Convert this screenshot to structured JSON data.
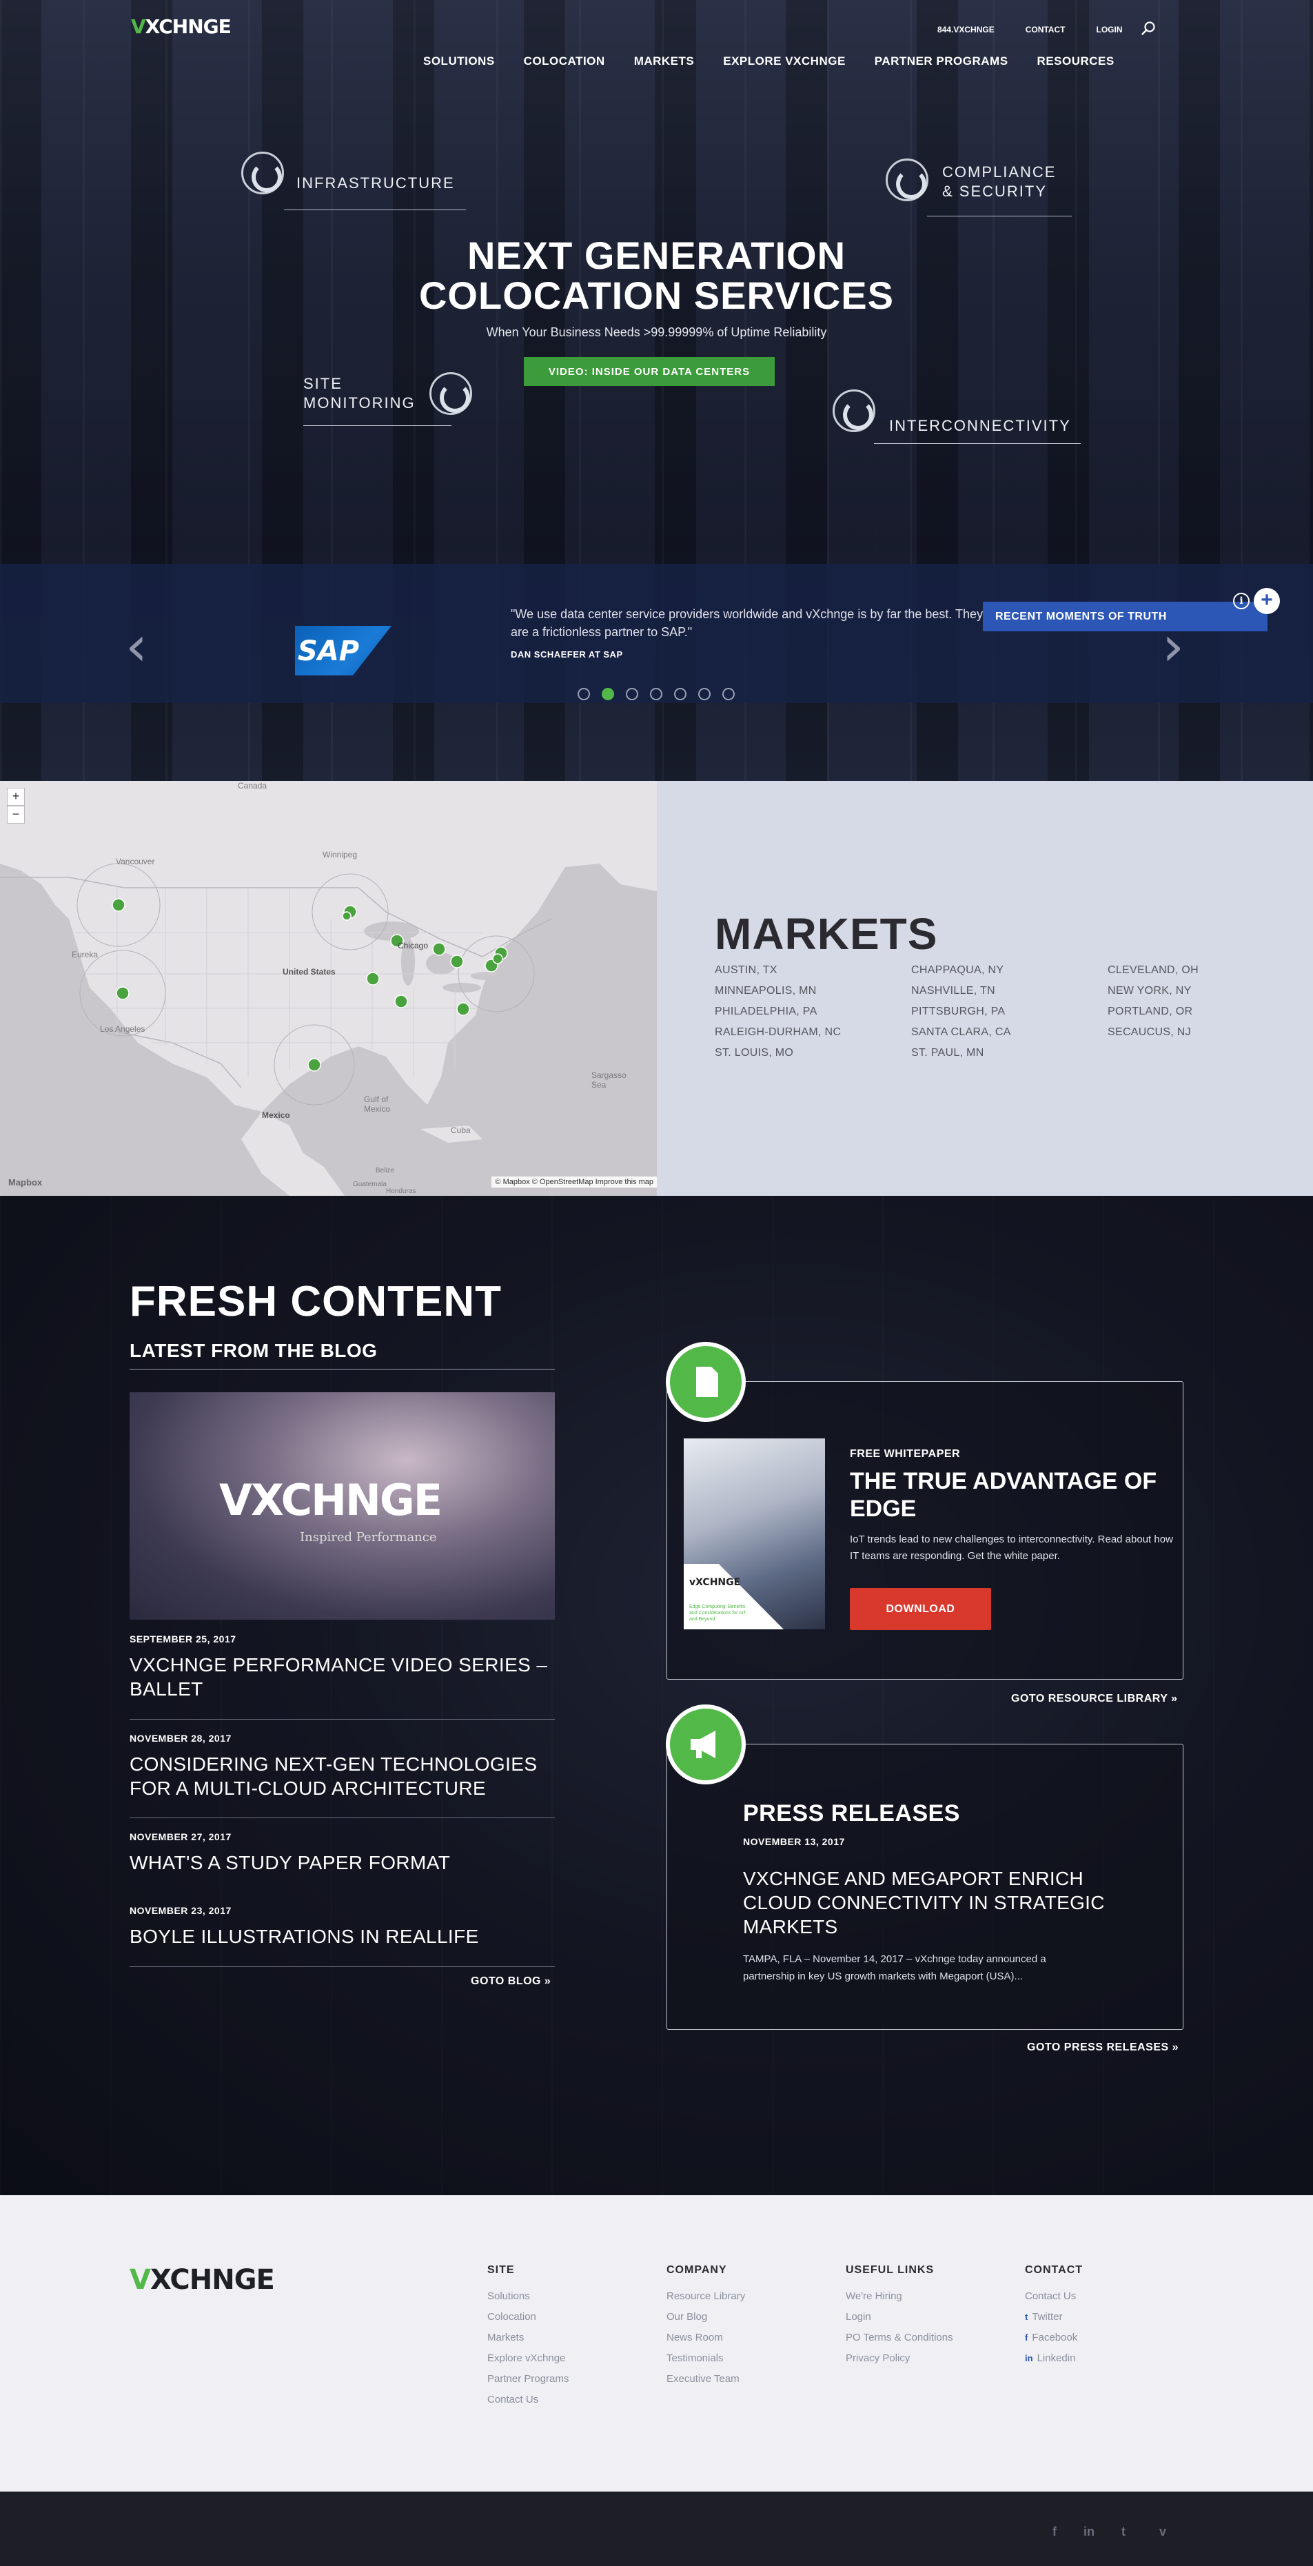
{
  "brand": {
    "logo_v": "V",
    "logo_rest": "XCHNGE",
    "logo_full": "vXCHNGE",
    "accent": "#52b848",
    "blue": "#2c57b6",
    "red": "#d9382c"
  },
  "utility_nav": {
    "phone": "844.VXCHNGE",
    "contact": "CONTACT",
    "login": "LOGIN",
    "search_icon": "search-icon"
  },
  "main_nav": [
    "SOLUTIONS",
    "COLOCATION",
    "MARKETS",
    "EXPLORE VXCHNGE",
    "PARTNER PROGRAMS",
    "RESOURCES"
  ],
  "hero": {
    "title_line1": "NEXT GENERATION",
    "title_line2": "COLOCATION SERVICES",
    "subtitle": "When Your Business Needs >99.99999% of Uptime Reliability",
    "button": "VIDEO: INSIDE OUR DATA CENTERS",
    "features": {
      "infrastructure": "INFRASTRUCTURE",
      "compliance_1": "COMPLIANCE",
      "compliance_2": "& SECURITY",
      "monitoring_1": "SITE",
      "monitoring_2": "MONITORING",
      "interconnectivity": "INTERCONNECTIVITY"
    }
  },
  "testimonial": {
    "logo": "SAP",
    "quote": "\"We use data center service providers worldwide and vXchnge is by far the best. They are a frictionless partner to SAP.\"",
    "author": "DAN SCHAEFER AT SAP",
    "moments_button": "RECENT MOMENTS OF TRUTH",
    "info": "i",
    "plus": "+",
    "prev": "‹",
    "next": "›",
    "dot_count": 7,
    "active_dot": 2
  },
  "map": {
    "zoom_in": "+",
    "zoom_out": "−",
    "attribution": "© Mapbox © OpenStreetMap Improve this map",
    "mapbox": "Mapbox",
    "labels": {
      "canada": "Canada",
      "vancouver": "Vancouver",
      "winnipeg": "Winnipeg",
      "united_states": "United States",
      "chicago": "Chicago",
      "los_angeles": "Los Angeles",
      "eureka": "Eureka",
      "gulf": "Gulf of Mexico",
      "mexico": "Mexico",
      "cuba": "Cuba",
      "sargasso": "Sargasso Sea",
      "guatemala": "Guatemala",
      "belize": "Belize",
      "honduras": "Honduras"
    }
  },
  "markets": {
    "title": "MARKETS",
    "cities": [
      "AUSTIN, TX",
      "CHAPPAQUA, NY",
      "CLEVELAND, OH",
      "MINNEAPOLIS, MN",
      "NASHVILLE, TN",
      "NEW YORK, NY",
      "PHILADELPHIA, PA",
      "PITTSBURGH, PA",
      "PORTLAND, OR",
      "RALEIGH-DURHAM, NC",
      "SANTA CLARA, CA",
      "SECAUCUS, NJ",
      "ST. LOUIS, MO",
      "ST. PAUL, MN",
      ""
    ]
  },
  "fresh": {
    "title": "FRESH CONTENT",
    "blog_heading": "LATEST FROM THE BLOG",
    "blog_image_logo": "VXCHNGE",
    "blog_image_tagline": "Inspired Performance",
    "posts": [
      {
        "date": "SEPTEMBER 25, 2017",
        "title": "VXCHNGE PERFORMANCE VIDEO SERIES – BALLET"
      },
      {
        "date": "NOVEMBER 28, 2017",
        "title": "CONSIDERING NEXT-GEN TECHNOLOGIES FOR A MULTI-CLOUD ARCHITECTURE"
      },
      {
        "date": "NOVEMBER 27, 2017",
        "title": "WHAT'S A STUDY PAPER FORMAT"
      },
      {
        "date": "NOVEMBER 23, 2017",
        "title": "BOYLE ILLUSTRATIONS IN REALLIFE"
      }
    ],
    "goto_blog": "GOTO BLOG »",
    "whitepaper": {
      "badge_icon": "document-icon",
      "kicker": "FREE WHITEPAPER",
      "title": "THE TRUE ADVANTAGE OF EDGE",
      "description": "IoT trends lead to new challenges to interconnectivity. Read about how IT teams are responding. Get the white paper.",
      "button": "DOWNLOAD",
      "cover_logo": "vXCHNGE",
      "cover_caption": "Edge Computing: Benefits and Considerations for IoT and Beyond"
    },
    "goto_resources": "GOTO RESOURCE LIBRARY »",
    "press": {
      "badge_icon": "megaphone-icon",
      "title": "PRESS RELEASES",
      "date": "NOVEMBER 13, 2017",
      "headline": "VXCHNGE AND MEGAPORT ENRICH CLOUD CONNECTIVITY IN STRATEGIC MARKETS",
      "excerpt": "TAMPA, FLA – November 14, 2017 – vXchnge today announced a partnership in key US growth markets with Megaport (USA)..."
    },
    "goto_press": "GOTO PRESS RELEASES »"
  },
  "footer": {
    "columns": [
      {
        "heading": "SITE",
        "links": [
          "Solutions",
          "Colocation",
          "Markets",
          "Explore vXchnge",
          "Partner Programs",
          "Contact Us"
        ]
      },
      {
        "heading": "COMPANY",
        "links": [
          "Resource Library",
          "Our Blog",
          "News Room",
          "Testimonials",
          "Executive Team"
        ]
      },
      {
        "heading": "USEFUL LINKS",
        "links": [
          "We're Hiring",
          "Login",
          "PO Terms & Conditions",
          "Privacy Policy"
        ]
      },
      {
        "heading": "CONTACT",
        "links": [
          "Contact Us",
          "Twitter",
          "Facebook",
          "Linkedin"
        ]
      }
    ],
    "contact_icons": [
      "",
      "twitter-icon",
      "facebook-icon",
      "linkedin-icon"
    ],
    "social": [
      "f",
      "in",
      "t",
      "v"
    ]
  }
}
